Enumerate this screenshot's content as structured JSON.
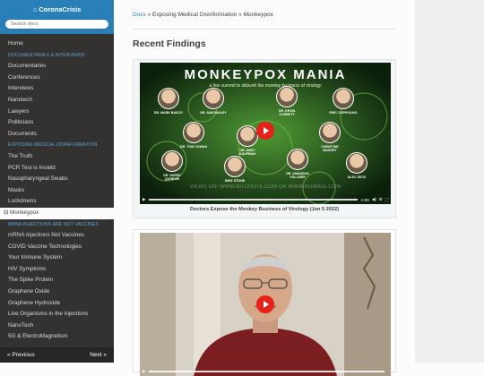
{
  "sidebar": {
    "title": "CoronaCrisis",
    "search_placeholder": "Search docs",
    "items": [
      {
        "label": "Home",
        "kind": "item"
      },
      {
        "label": "DOCUMENTARIES & INTERVIEWS",
        "kind": "caption"
      },
      {
        "label": "Documentaries",
        "kind": "item"
      },
      {
        "label": "Conferences",
        "kind": "item"
      },
      {
        "label": "Interviews",
        "kind": "item"
      },
      {
        "label": "Nanotech",
        "kind": "item"
      },
      {
        "label": "Lawyers",
        "kind": "item"
      },
      {
        "label": "Politicians",
        "kind": "item"
      },
      {
        "label": "Documents",
        "kind": "item"
      },
      {
        "label": "EXPOSING MEDICAL DISINFORMATION",
        "kind": "caption"
      },
      {
        "label": "The Truth",
        "kind": "item"
      },
      {
        "label": "PCR Test is Invalid",
        "kind": "item"
      },
      {
        "label": "Nasopharyngeal Swabs",
        "kind": "item"
      },
      {
        "label": "Masks",
        "kind": "item"
      },
      {
        "label": "Lockdowns",
        "kind": "item"
      },
      {
        "label": "Monkeypox",
        "kind": "current"
      },
      {
        "label": "MRNA INJECTIONS ARE NOT VACCINES",
        "kind": "caption"
      },
      {
        "label": "mRNA Injections Not Vaccines",
        "kind": "item"
      },
      {
        "label": "COVID Vaccine Technologies",
        "kind": "item"
      },
      {
        "label": "Your Immune System",
        "kind": "item"
      },
      {
        "label": "HIV Symptoms",
        "kind": "item"
      },
      {
        "label": "The Spike Protein",
        "kind": "item"
      },
      {
        "label": "Graphene Oxide",
        "kind": "item"
      },
      {
        "label": "Graphene Hydroxide",
        "kind": "item"
      },
      {
        "label": "Live Organisms in the Injections",
        "kind": "item"
      },
      {
        "label": "NanoTech",
        "kind": "item"
      },
      {
        "label": "5G & ElectroMagnetism",
        "kind": "item"
      }
    ],
    "previous": "« Previous",
    "next": "Next »"
  },
  "breadcrumb": {
    "docs": "Docs",
    "sep1": " » ",
    "section": "Exposing Medical Disinformation",
    "sep2": " » ",
    "page": "Monkeypox"
  },
  "main": {
    "heading": "Recent Findings",
    "video1": {
      "title": "MONKEYPOX MANIA",
      "subtitle": "a live summit to debunk the monkey business of virology",
      "caption": "Doctors Expose the Monkey Business of Virology (Jun 5 2022)",
      "watermark": "VIEWS ON: WWW.BITCHUTE.COM OR WWW.RUMBLE.COM",
      "time": "0:00",
      "speakers": [
        "DR. MARK BAILEY",
        "DR. SAM BAILEY",
        "DR. KEVIN CORBETT",
        "ERIC COPPOLINO",
        "DR. TOM COWAN",
        "DR. ANDY KAUFMAN",
        "CHRISTINE MASSEY",
        "DR. SAEED QURESHI",
        "MIKE STONE",
        "DR. AMANDHA VOLLMER",
        "ALEC ZECK"
      ]
    }
  },
  "colors": {
    "brand": "#2980b9",
    "sidebar_bg": "#343131",
    "play": "#e62117",
    "virus_green": "#3f8a2b"
  }
}
